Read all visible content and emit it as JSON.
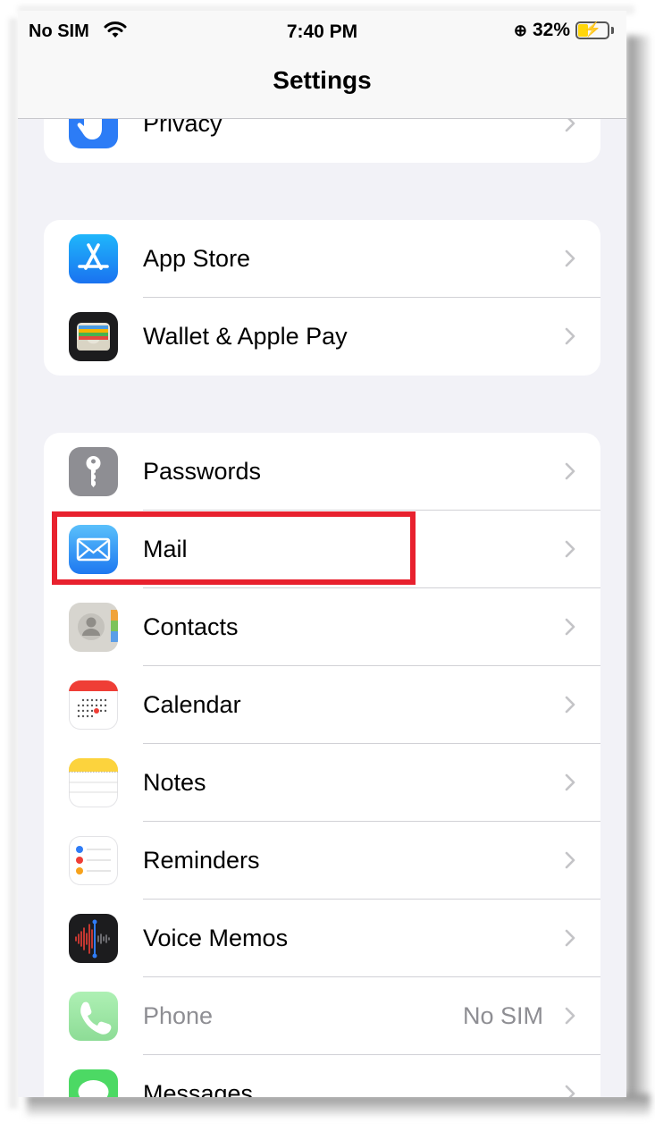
{
  "status_bar": {
    "carrier": "No SIM",
    "time": "7:40 PM",
    "lock_glyph": "⊕",
    "battery_percent": "32%",
    "battery_level": 0.32,
    "charging": true
  },
  "nav": {
    "title": "Settings"
  },
  "groups": [
    {
      "rows": [
        {
          "label": "Privacy",
          "icon": "hand-icon",
          "icon_color": "#2c7cf6"
        }
      ]
    },
    {
      "rows": [
        {
          "label": "App Store",
          "icon": "app-store-icon",
          "icon_color": "#1a8cf9"
        },
        {
          "label": "Wallet & Apple Pay",
          "icon": "wallet-icon",
          "icon_color": "#1c1c1e"
        }
      ]
    },
    {
      "rows": [
        {
          "label": "Passwords",
          "icon": "key-icon",
          "icon_color": "#8e8e93"
        },
        {
          "label": "Mail",
          "icon": "mail-icon",
          "icon_color": "#2f8af5"
        },
        {
          "label": "Contacts",
          "icon": "contacts-icon",
          "icon_color": "#d0cec8"
        },
        {
          "label": "Calendar",
          "icon": "calendar-icon",
          "icon_color": "#ffffff"
        },
        {
          "label": "Notes",
          "icon": "notes-icon",
          "icon_color": "#ffffff"
        },
        {
          "label": "Reminders",
          "icon": "reminders-icon",
          "icon_color": "#ffffff"
        },
        {
          "label": "Voice Memos",
          "icon": "voice-memos-icon",
          "icon_color": "#1c1c1e"
        },
        {
          "label": "Phone",
          "value": "No SIM",
          "icon": "phone-icon",
          "icon_color": "#9fe6a8"
        },
        {
          "label": "Messages",
          "icon": "messages-icon",
          "icon_color": "#4cd964"
        }
      ]
    }
  ],
  "highlight_color": "#e8212e"
}
